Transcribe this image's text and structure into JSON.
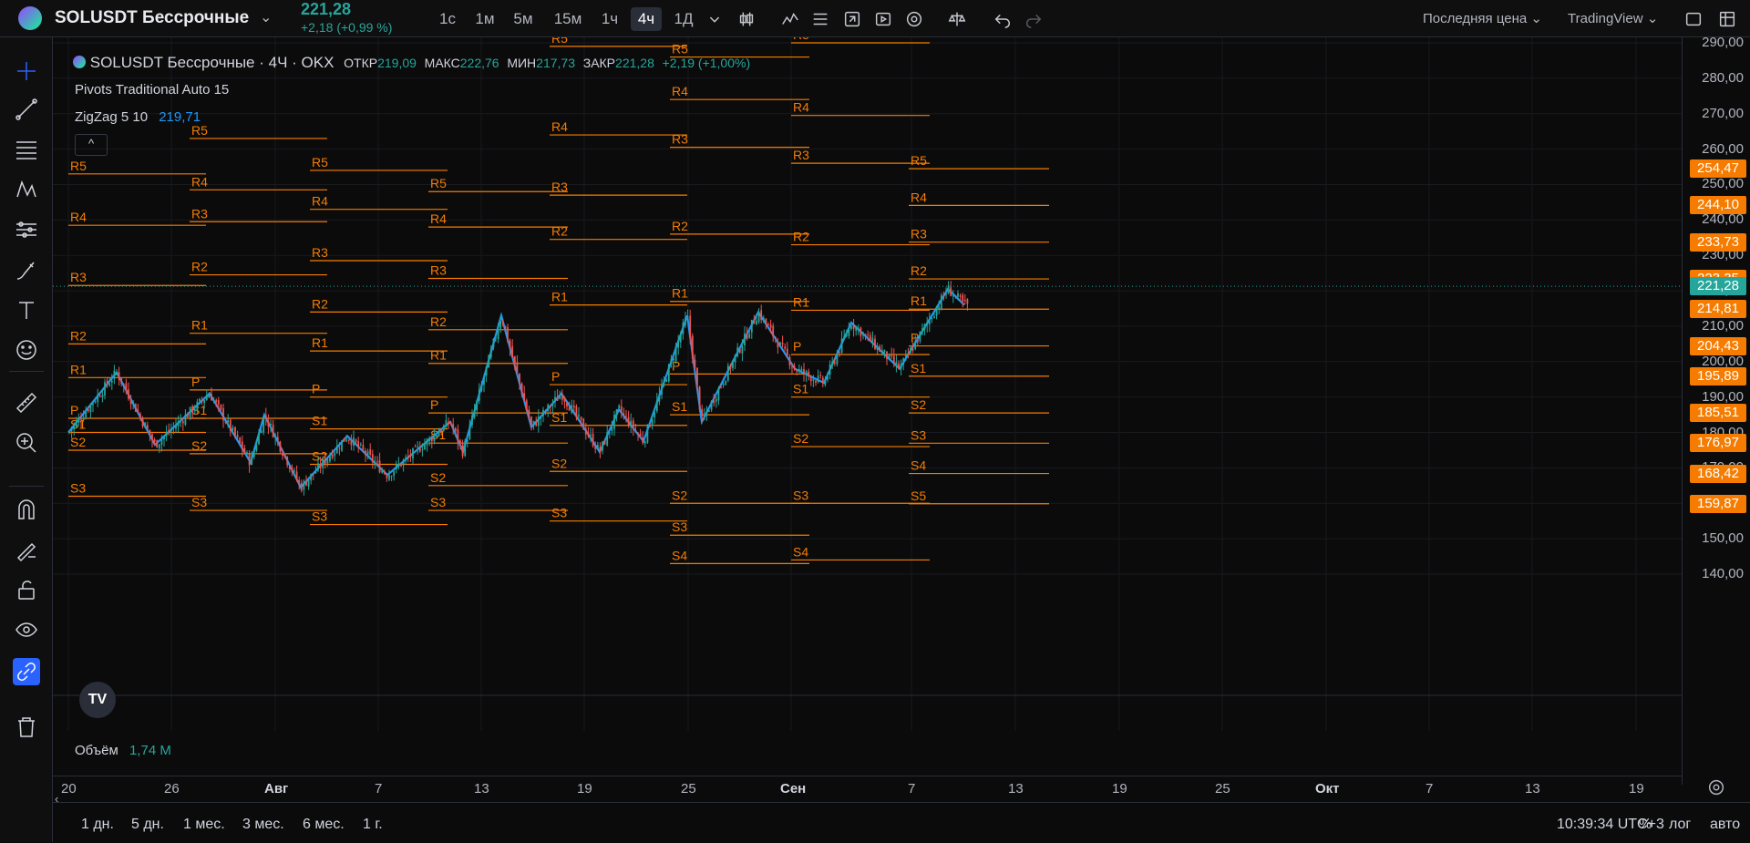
{
  "header": {
    "symbol": "SOLUSDT Бессрочные",
    "price": "221,28",
    "change": "+2,18 (+0,99 %)",
    "timeframes": [
      "1с",
      "1м",
      "5м",
      "15м",
      "1ч",
      "4ч",
      "1Д"
    ],
    "active_timeframe": "4ч",
    "price_type": "Последняя цена",
    "broker": "TradingView",
    "icons": [
      "chevron-down-icon",
      "candles-icon",
      "indicators-icon",
      "templates-icon",
      "alert-icon",
      "replay-icon",
      "settings-icon",
      "balance-icon",
      "undo-icon",
      "redo-icon",
      "fullscreen-icon",
      "snapshot-icon"
    ]
  },
  "legend": {
    "title": "SOLUSDT Бессрочные · 4Ч · OKX",
    "o_label": "ОТКР",
    "o": "219,09",
    "h_label": "МАКС",
    "h": "222,76",
    "l_label": "МИН",
    "l": "217,73",
    "c_label": "ЗАКР",
    "c": "221,28",
    "chg": "+2,19 (+1,00%)",
    "indicator1": "Pivots Traditional Auto 15",
    "indicator2_name": "ZigZag 5 10",
    "indicator2_value": "219,71",
    "collapse": "^"
  },
  "volume": {
    "label": "Объём",
    "value": "1,74 М"
  },
  "price_scale": {
    "ticks": [
      "290,00",
      "280,00",
      "270,00",
      "260,00",
      "250,00",
      "240,00",
      "230,00",
      "220,00",
      "210,00",
      "200,00",
      "190,00",
      "180,00",
      "170,00",
      "160,00",
      "150,00",
      "140,00"
    ],
    "badges": [
      {
        "text": "254,47",
        "color": "#f57c00"
      },
      {
        "text": "244,10",
        "color": "#f57c00"
      },
      {
        "text": "233,73",
        "color": "#f57c00"
      },
      {
        "text": "223,35",
        "color": "#f57c00"
      },
      {
        "text": "221,28",
        "color": "#26a69a"
      },
      {
        "text": "214,81",
        "color": "#f57c00"
      },
      {
        "text": "204,43",
        "color": "#f57c00"
      },
      {
        "text": "195,89",
        "color": "#f57c00"
      },
      {
        "text": "185,51",
        "color": "#f57c00"
      },
      {
        "text": "176,97",
        "color": "#f57c00"
      },
      {
        "text": "168,42",
        "color": "#f57c00"
      },
      {
        "text": "159,87",
        "color": "#f57c00"
      }
    ]
  },
  "time_axis": [
    "20",
    "26",
    "Авг",
    "7",
    "13",
    "19",
    "25",
    "Сен",
    "7",
    "13",
    "19",
    "25",
    "Окт",
    "7",
    "13",
    "19"
  ],
  "bottom": {
    "ranges": [
      "1 дн.",
      "5 дн.",
      "1 мес.",
      "3 мес.",
      "6 мес.",
      "1 г."
    ],
    "clock": "10:39:34 UTC+3",
    "percent": "%",
    "log": "лог",
    "auto": "авто"
  },
  "pivot_labels": [
    "R5",
    "R4",
    "R3",
    "R2",
    "R1",
    "P",
    "S1",
    "S2",
    "S3",
    "S4",
    "S5"
  ],
  "colors": {
    "up": "#26a69a",
    "down": "#ef5350",
    "pivot": "#f57c00",
    "zigzag": "#2196f3"
  }
}
